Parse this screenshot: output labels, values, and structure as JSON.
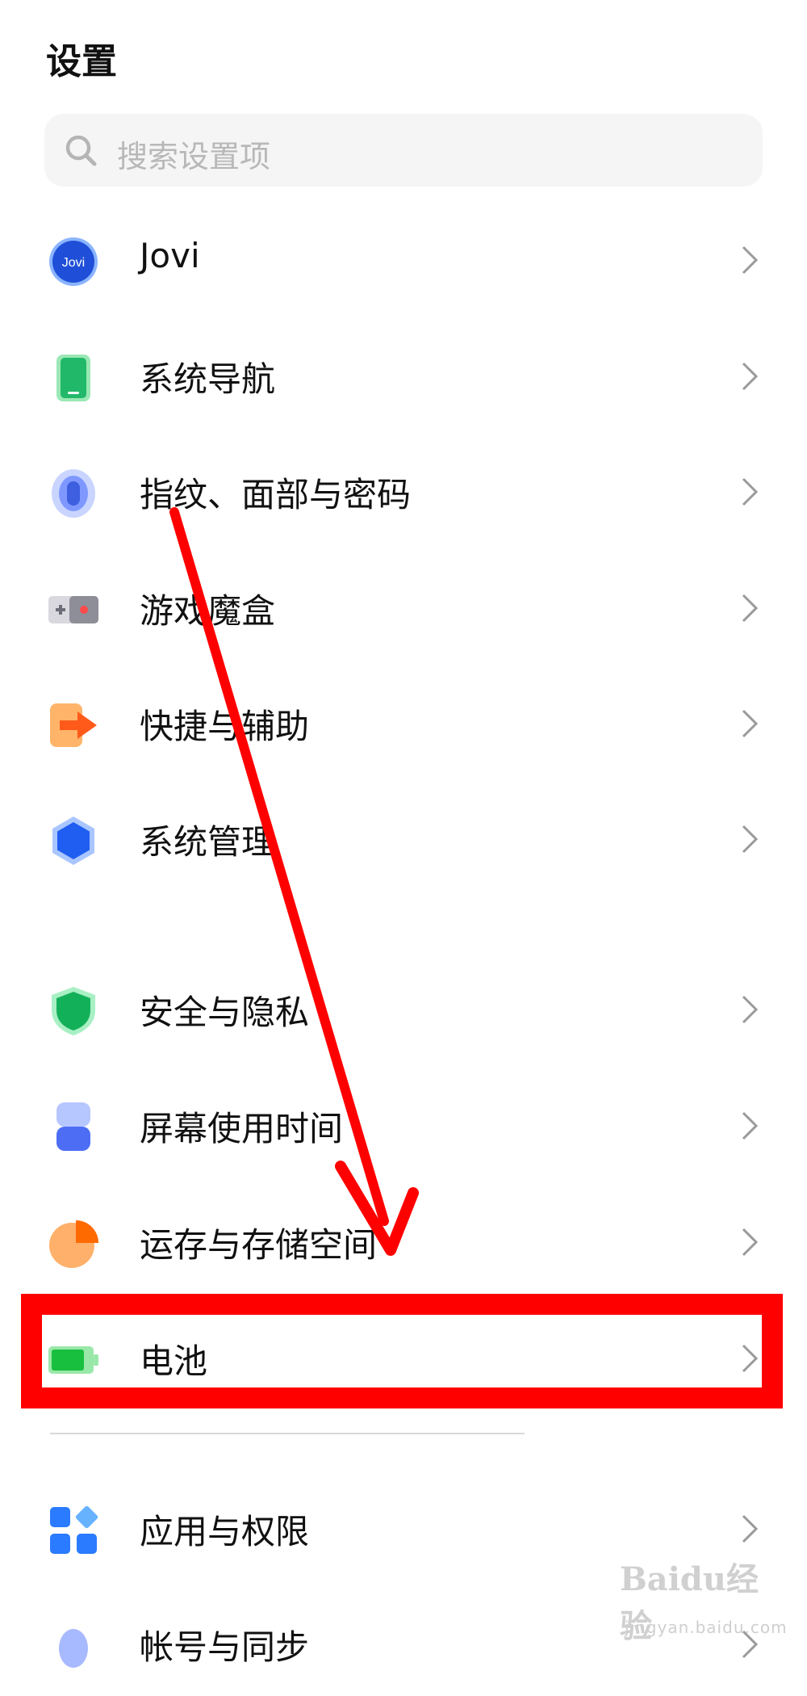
{
  "page_title": "设置",
  "search": {
    "placeholder": "搜索设置项",
    "icon": "search-icon"
  },
  "items": [
    {
      "label": "Jovi",
      "icon": "jovi-icon",
      "icon_text": "Jovi"
    },
    {
      "label": "系统导航",
      "icon": "phone-navigation-icon"
    },
    {
      "label": "指纹、面部与密码",
      "icon": "fingerprint-icon"
    },
    {
      "label": "游戏魔盒",
      "icon": "game-box-icon"
    },
    {
      "label": "快捷与辅助",
      "icon": "shortcut-arrow-icon"
    },
    {
      "label": "系统管理",
      "icon": "hexagon-system-icon"
    },
    {
      "label": "安全与隐私",
      "icon": "shield-icon"
    },
    {
      "label": "屏幕使用时间",
      "icon": "hourglass-icon"
    },
    {
      "label": "运存与存储空间",
      "icon": "pie-storage-icon"
    },
    {
      "label": "电池",
      "icon": "battery-icon",
      "highlighted": true
    },
    {
      "label": "应用与权限",
      "icon": "apps-grid-icon"
    },
    {
      "label": "帐号与同步",
      "icon": "account-icon"
    }
  ],
  "annotation": {
    "highlight_color": "#ff0000",
    "arrow_color": "#ff0000"
  },
  "watermark": {
    "logo_text": "Baidu经验",
    "url_text": "jingyan.baidu.com"
  },
  "colors": {
    "accent_blue": "#3d6df2",
    "battery_green": "#22c34a",
    "divider": "#d9d9d9"
  }
}
